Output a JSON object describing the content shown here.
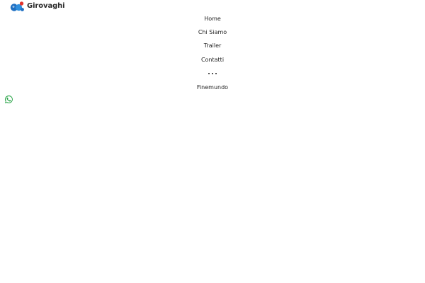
{
  "header": {
    "brand_name": "Girovaghi",
    "logo_icon": "girovaghi-logo-icon"
  },
  "nav": {
    "items": [
      {
        "label": "Home"
      },
      {
        "label": "Chi Siamo"
      },
      {
        "label": "Trailer"
      },
      {
        "label": "Contatti"
      },
      {
        "icon": "more-dots-icon"
      },
      {
        "label": "Finemundo"
      }
    ]
  },
  "floating": {
    "icon": "whatsapp-icon"
  },
  "colors": {
    "logo_blue": "#1f6fc2",
    "logo_red": "#e2332c",
    "whatsapp_green": "#25a244",
    "text": "#1e1e1e"
  }
}
